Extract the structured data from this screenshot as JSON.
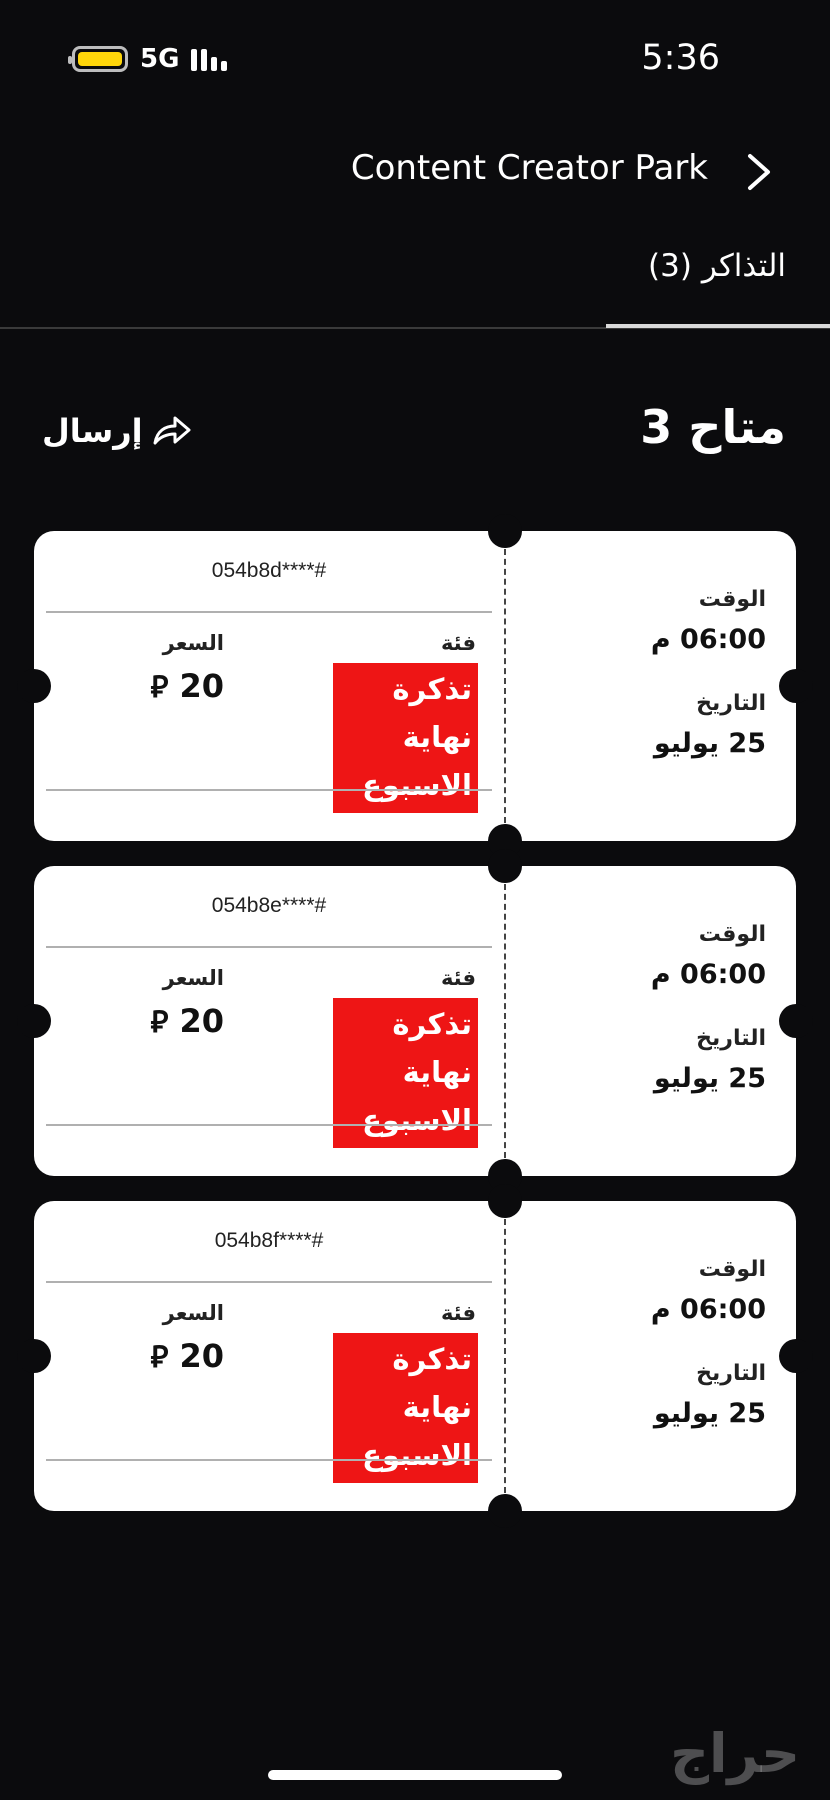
{
  "status_bar": {
    "time": "5:36",
    "network": "5G",
    "battery_color": "#ffd60a"
  },
  "header": {
    "title": "Content Creator Park",
    "back_icon": "chevron-right-icon"
  },
  "tabs": [
    {
      "label": "التذاكر (3)",
      "active": true
    }
  ],
  "summary": {
    "available": "متاح 3",
    "send_label": "إرسال",
    "send_icon": "share-arrow-icon"
  },
  "labels": {
    "time": "الوقت",
    "date": "التاريخ",
    "category": "فئة",
    "price": "السعر"
  },
  "tickets": [
    {
      "number": "054b8d****#",
      "time": "06:00 م",
      "date": "25 يوليو",
      "category": "تذكرة نهاية الاسبوع",
      "price": "20",
      "currency_symbol": "⃁"
    },
    {
      "number": "054b8e****#",
      "time": "06:00 م",
      "date": "25 يوليو",
      "category": "تذكرة نهاية الاسبوع",
      "price": "20",
      "currency_symbol": "⃁"
    },
    {
      "number": "054b8f****#",
      "time": "06:00 م",
      "date": "25 يوليو",
      "category": "تذكرة نهاية الاسبوع",
      "price": "20",
      "currency_symbol": "⃁"
    }
  ],
  "watermark": "حراج",
  "colors": {
    "background": "#0b0b0d",
    "category_badge": "#ee1515",
    "ticket": "#ffffff"
  }
}
